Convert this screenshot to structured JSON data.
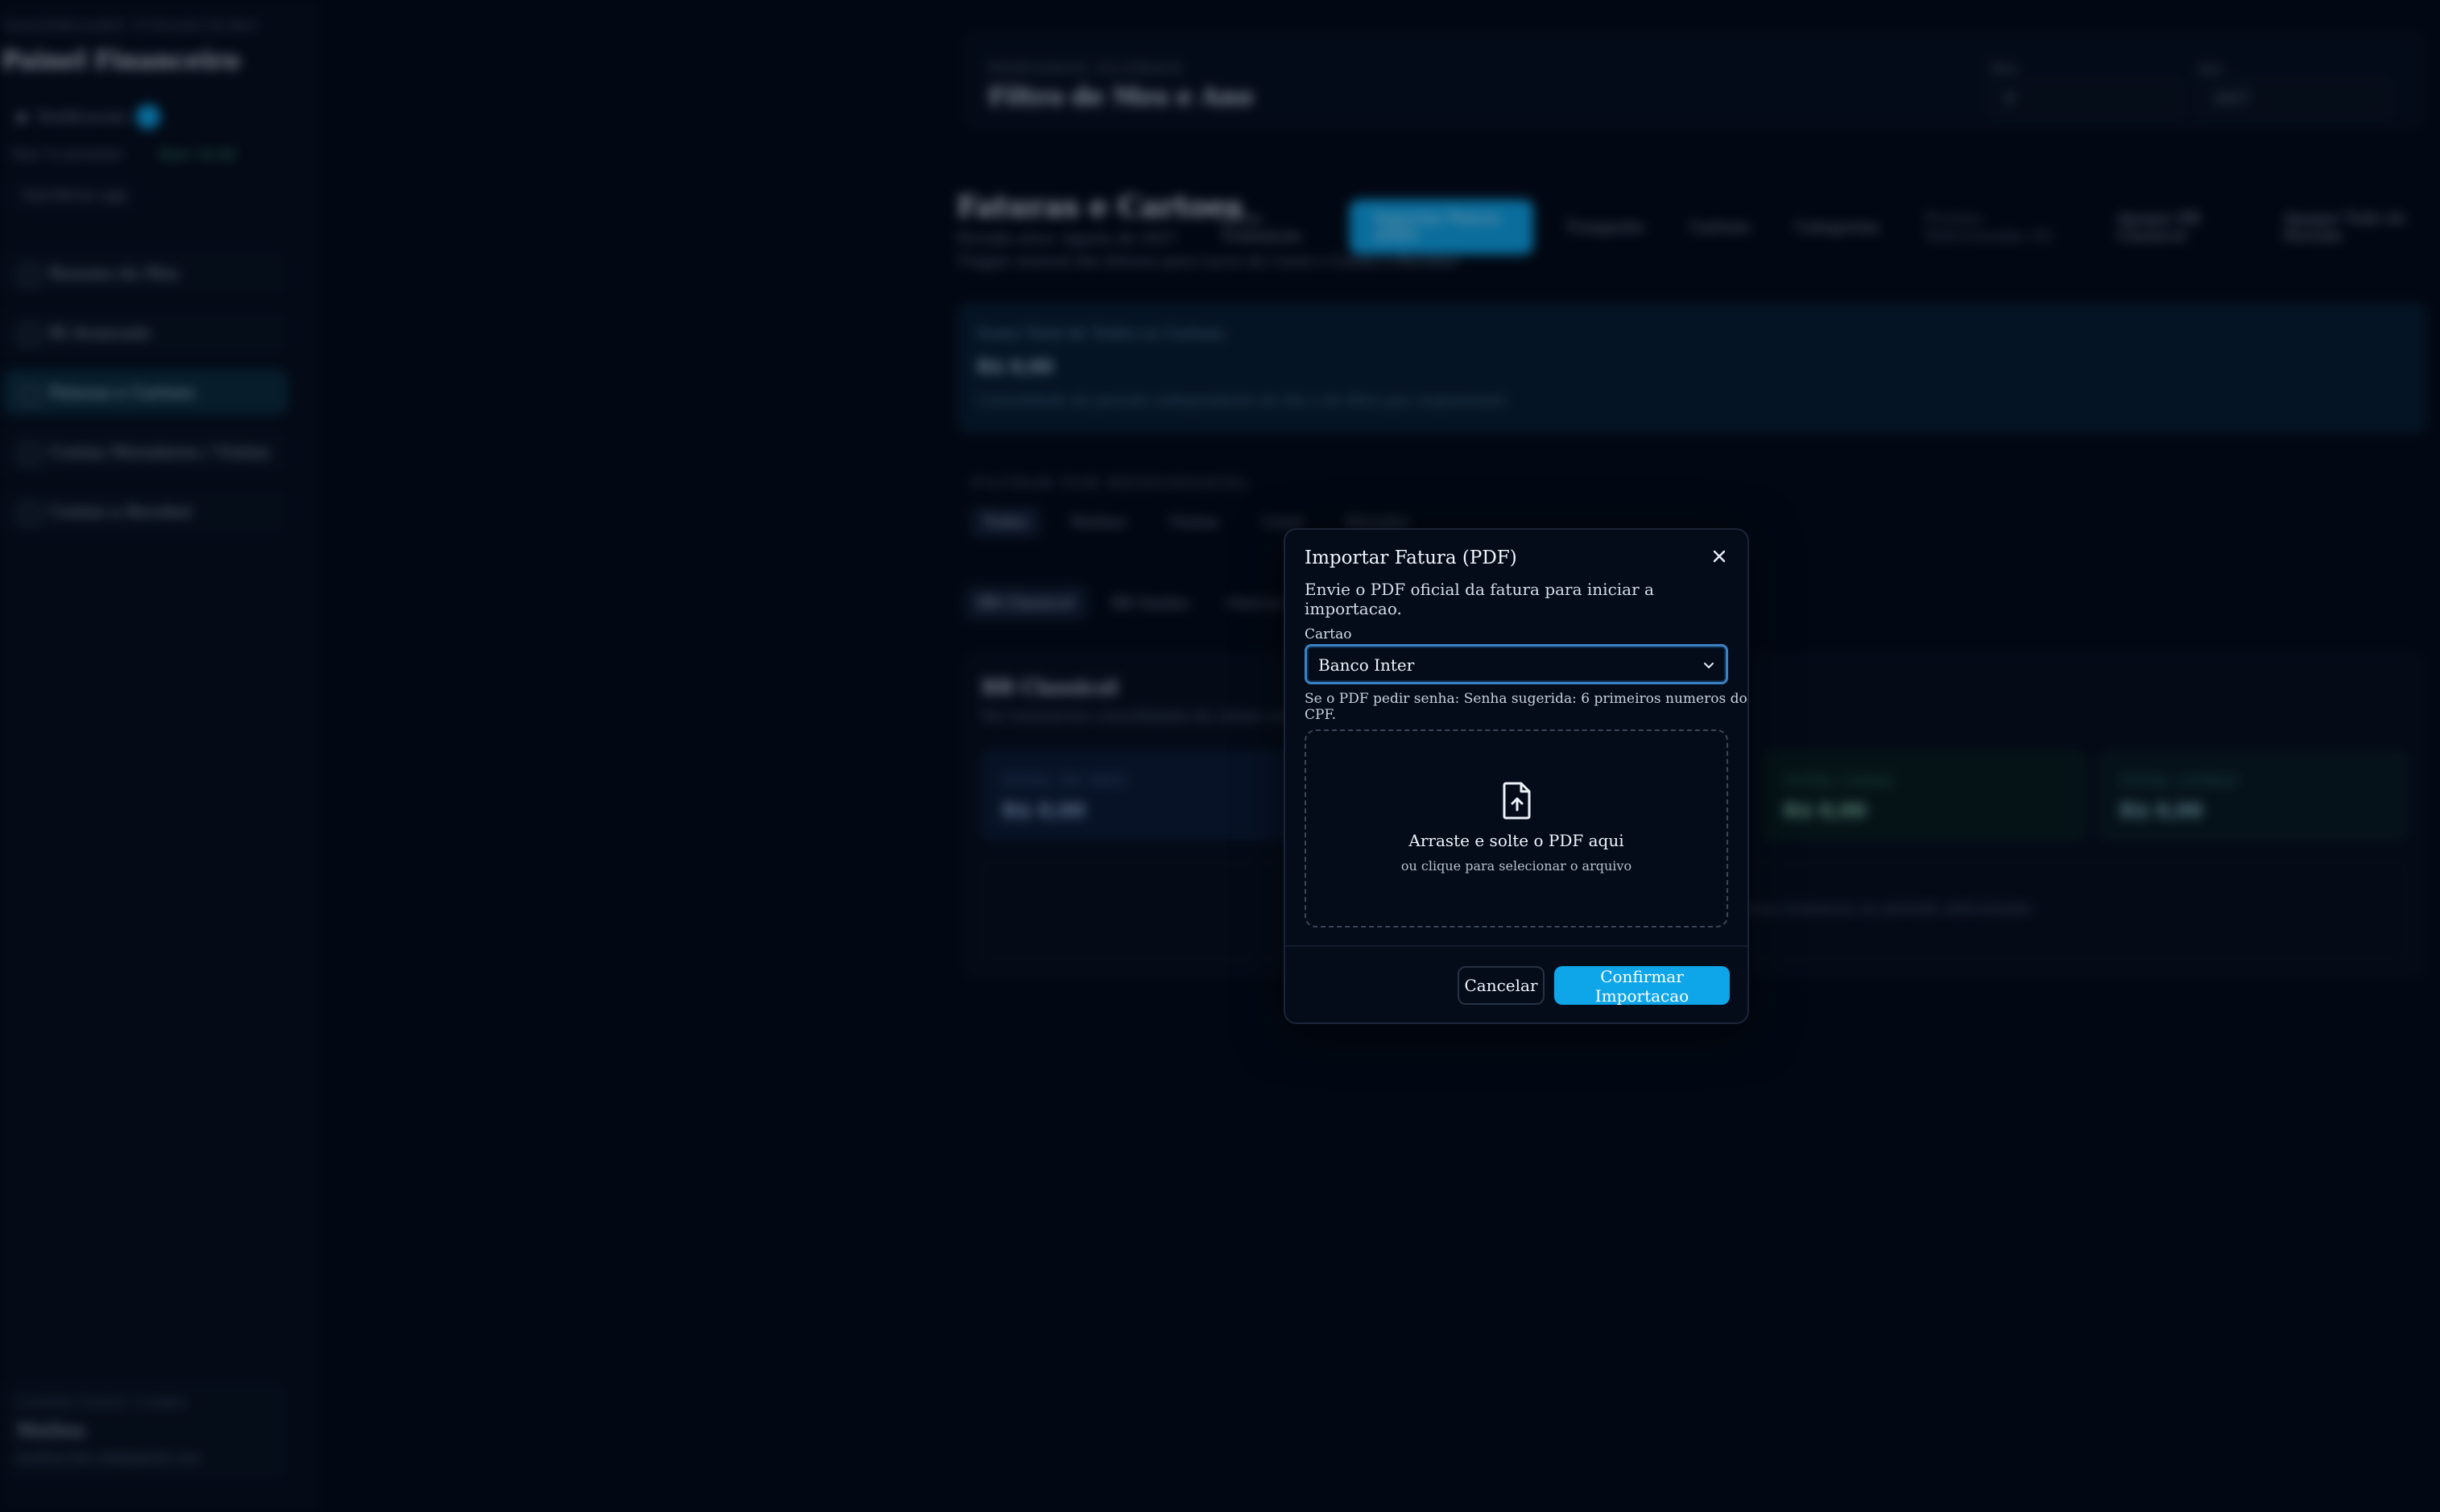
{
  "sidebar": {
    "kicker": "DASHBOARD FINANCEIRO",
    "title": "Painel Financeiro",
    "notifications": "Notificacoes",
    "period": "Sinc.% Jornalist.",
    "sync": "Sync 1h 6d",
    "logout": "Sair/Ativar app",
    "items": [
      {
        "label": "Resumo do Mes"
      },
      {
        "label": "BI Avancado"
      },
      {
        "label": "Faturas e Cartoes"
      },
      {
        "label": "Contas Moradores / Visitas"
      },
      {
        "label": "Contas a Receber"
      }
    ],
    "account": {
      "kicker": "CONECTADO COMO",
      "name": "Mathea",
      "email": "mathea.frnc.diz@gmail.com"
    }
  },
  "filters": {
    "kicker": "PERIODOS GLOBAIS",
    "title": "Filtro de Mes e Ano",
    "month_label": "Mes",
    "month_value": "8",
    "year_label": "Ano",
    "year_value": "2027"
  },
  "page": {
    "title": "Faturas e Cartoes",
    "subtitle1": "Periodo ativo: Agosto de 2027",
    "subtitle2": "Trigger manual das faturas para Lucro do Casal e Contas a Receber",
    "actions": [
      "Nova Transacao",
      "Importar Fatura (PDF)",
      "Tranposto",
      "Cartoes",
      "Categorias",
      "Formas Selecionadas (0)",
      "Apagar BB Classicol",
      "Apagar Todo do Periodo"
    ]
  },
  "total_card": {
    "label": "Soma Total de Todos os Cartoes",
    "value": "R$ 0,00",
    "note": "Consolidado do periodo independente do dia e do filtro por responsavel."
  },
  "responsible": {
    "kicker": "FILTRAR POR RESPONSAVEL",
    "chips": [
      "Todos",
      "Mathea",
      "Visitas",
      "Casal",
      "Morador"
    ]
  },
  "card_tabs": [
    "BB Classicol",
    "BB Smiles",
    "Outros Cartoes"
  ],
  "panel": {
    "title": "BB Classicol",
    "subtitle": "Ver transacoes consolidadas do classe com um responsavel",
    "stats": [
      {
        "label": "TOTAL DO MES",
        "value": "R$ 0,00"
      },
      {
        "label": "TOTAL CASAL",
        "value": "R$ 0,00"
      },
      {
        "label": "TOTAL LIVRAS",
        "value": "R$ 0,00"
      }
    ],
    "empty": "Nenhuma transacao no periodo selecionado."
  },
  "modal": {
    "title": "Importar Fatura (PDF)",
    "description": "Envie o PDF oficial da fatura para iniciar a importacao.",
    "card_label": "Cartao",
    "card_selected": "Banco Inter",
    "password_hint": "Se o PDF pedir senha: Senha sugerida: 6 primeiros numeros do CPF.",
    "drop_title": "Arraste e solte o PDF aqui",
    "drop_subtitle": "ou clique para selecionar o arquivo",
    "cancel_label": "Cancelar",
    "confirm_label": "Confirmar Importacao"
  },
  "colors": {
    "background": "#030a16",
    "accent": "#0ea5e9",
    "modal_bg": "#040c1a",
    "focus_ring": "#3b82c4"
  },
  "icons": [
    "close-icon",
    "chevron-down-icon",
    "file-upload-icon",
    "bell-icon",
    "calendar-icon"
  ]
}
